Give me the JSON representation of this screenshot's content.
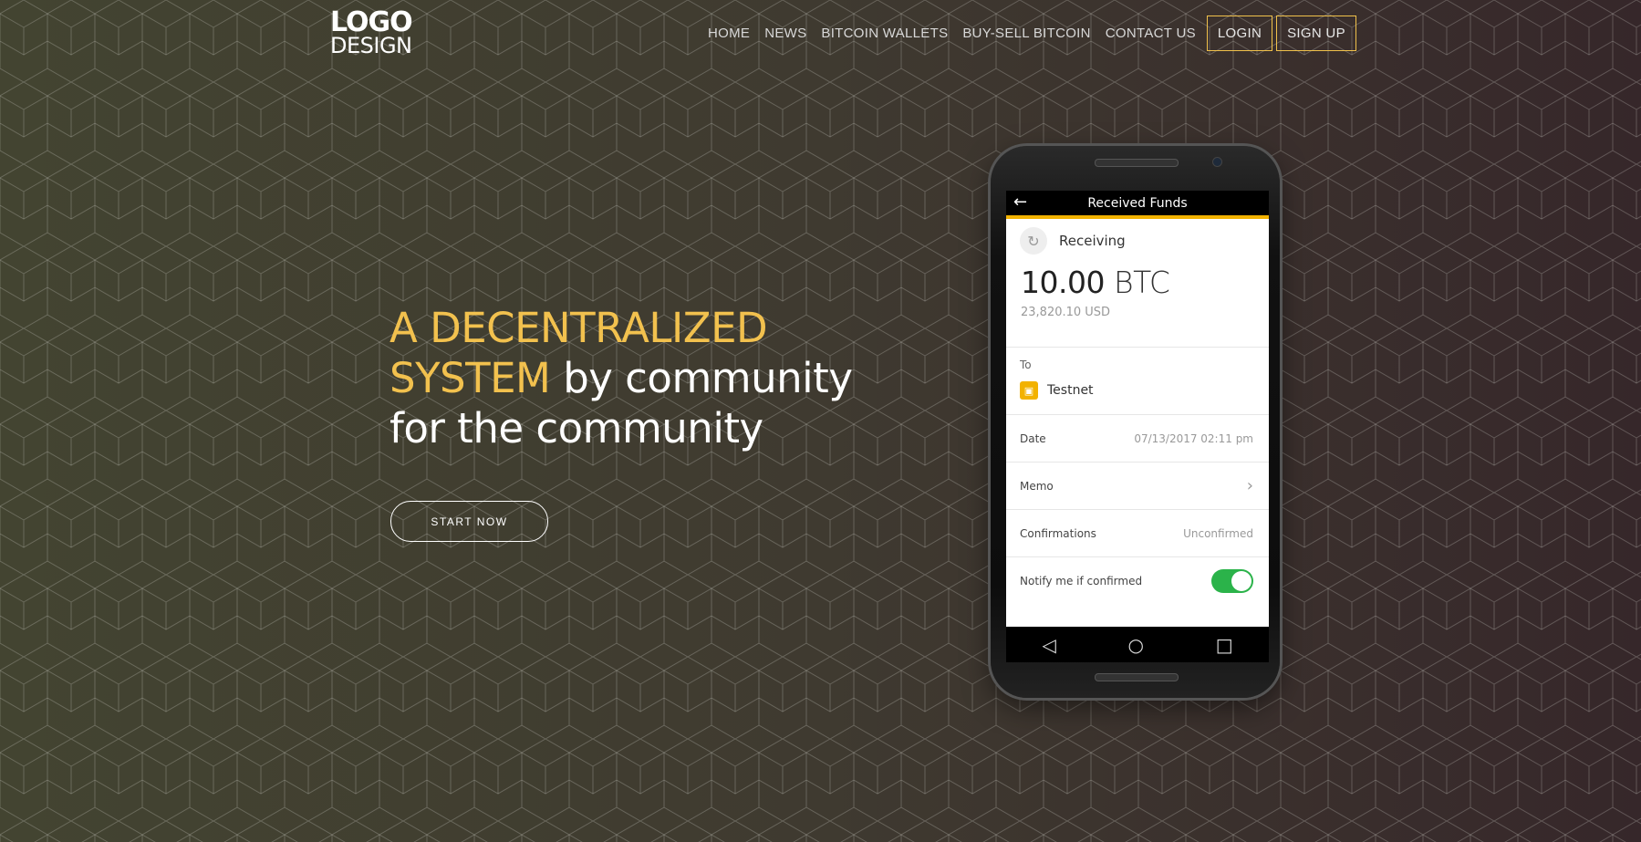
{
  "logo": {
    "line1": "LOGO",
    "line2": "DESIGN"
  },
  "nav": {
    "items": [
      "HOME",
      "NEWS",
      "BITCOIN WALLETS",
      "BUY-SELL BITCOIN",
      "CONTACT US"
    ],
    "login": "LOGIN",
    "signup": "SIGN UP"
  },
  "hero": {
    "accent1": "A DECENTRALIZED",
    "accent2": "SYSTEM",
    "rest1": "by community",
    "rest2": "for the community",
    "cta": "START NOW"
  },
  "phone": {
    "title": "Received Funds",
    "status": "Receiving",
    "amount": "10.00",
    "unit": "BTC",
    "usd": "23,820.10 USD",
    "to_label": "To",
    "wallet": "Testnet",
    "rows": [
      {
        "label": "Date",
        "value": "07/13/2017 02:11 pm"
      },
      {
        "label": "Memo",
        "value": "›"
      },
      {
        "label": "Confirmations",
        "value": "Unconfirmed"
      },
      {
        "label": "Notify me if confirmed",
        "value": ""
      }
    ],
    "icons": {
      "back": "back-arrow-icon",
      "nav": [
        "back-triangle-icon",
        "home-circle-icon",
        "recents-square-icon"
      ]
    }
  },
  "colors": {
    "accent": "#f2c14e",
    "toggle": "#2bb34a",
    "wallet": "#f2b200"
  }
}
